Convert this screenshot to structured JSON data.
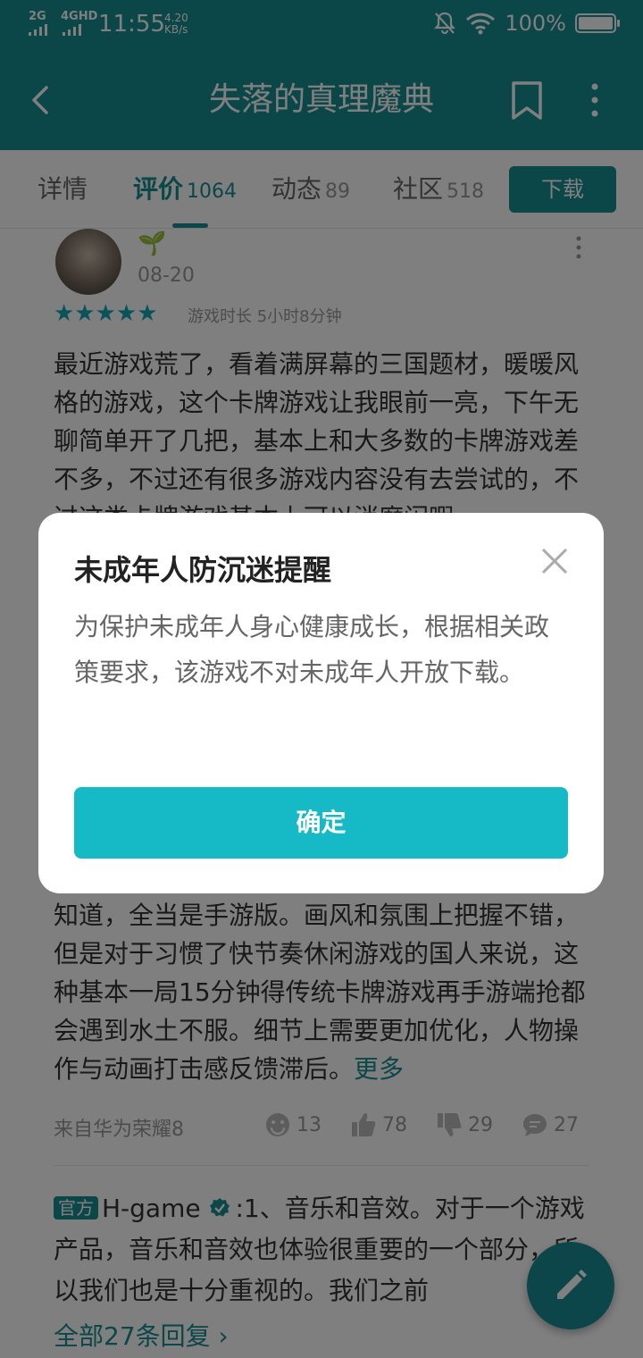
{
  "status_bar": {
    "signal_1": "2G",
    "signal_2": "4GHD",
    "time": "11:55",
    "net_speed": "4.20",
    "net_unit": "KB/s",
    "battery": "100%"
  },
  "header": {
    "title": "失落的真理魔典",
    "back_icon": "back-arrow-icon",
    "bookmark_icon": "bookmark-icon",
    "more_icon": "more-vertical-icon"
  },
  "tabs": [
    {
      "label": "详情",
      "count": ""
    },
    {
      "label": "评价",
      "count": "1064"
    },
    {
      "label": "动态",
      "count": "89"
    },
    {
      "label": "社区",
      "count": "518"
    }
  ],
  "download_label": "下载",
  "review": {
    "date": "08-20",
    "rating": 5,
    "stars": "★★★★★",
    "playtime": "游戏时长 5小时8分钟",
    "text_top": "最近游戏荒了，看着满屏幕的三国题材，暖暖风格的游戏，这个卡牌游戏让我眼前一亮，下午无聊简单开了几把，基本上和大多数的卡牌游戏差不多，不过还有很多游戏内容没有去尝试的，不过这类卡牌游戏基本上可以消磨闲暇",
    "text_bottom": "知道，全当是手游版。画风和氛围上把握不错，但是对于习惯了快节奏休闲游戏的国人来说，这种基本一局15分钟得传统卡牌游戏再手游端抢都会遇到水土不服。细节上需要更加优化，人物操作与动画打击感反馈滞后。",
    "more_label": "更多",
    "device": "来自华为荣耀8",
    "stats": {
      "smile": "13",
      "like": "78",
      "dislike": "29",
      "comment": "27"
    }
  },
  "reply": {
    "badge": "官方",
    "author": "H-game",
    "text": ":1、音乐和音效。对于一个游戏产品，音乐和音效也体验很重要的一个部分，所以我们也是十分重视的。我们之前",
    "all_replies": "全部27条回复 ›"
  },
  "modal": {
    "title": "未成年人防沉迷提醒",
    "body": "为保护未成年人身心健康成长，根据相关政策要求，该游戏不对未成年人开放下载。",
    "confirm": "确定"
  },
  "colors": {
    "primary": "#178c93",
    "confirm_button": "#16bac6",
    "star": "#16a7b5"
  }
}
